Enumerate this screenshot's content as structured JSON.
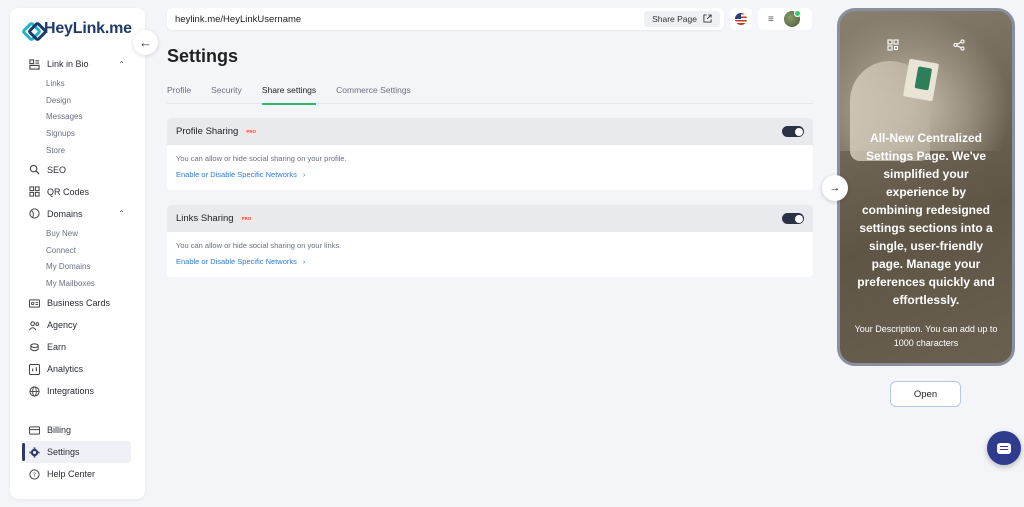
{
  "brand": {
    "name": "HeyLink.me",
    "color": "#1f3b6d",
    "accent": "#23b5c8"
  },
  "sidebar": {
    "items": [
      {
        "label": "Link in Bio",
        "icon": "layout-icon",
        "expanded": true,
        "children": [
          "Links",
          "Design",
          "Messages",
          "Signups",
          "Store"
        ]
      },
      {
        "label": "SEO",
        "icon": "search-icon"
      },
      {
        "label": "QR Codes",
        "icon": "grid-icon"
      },
      {
        "label": "Domains",
        "icon": "globe-icon",
        "expanded": true,
        "children": [
          "Buy New",
          "Connect",
          "My Domains",
          "My Mailboxes"
        ]
      },
      {
        "label": "Business Cards",
        "icon": "id-card-icon"
      },
      {
        "label": "Agency",
        "icon": "users-icon"
      },
      {
        "label": "Earn",
        "icon": "coins-icon"
      },
      {
        "label": "Analytics",
        "icon": "chart-icon"
      },
      {
        "label": "Integrations",
        "icon": "globe-icon"
      }
    ],
    "bottom": [
      {
        "label": "Billing",
        "icon": "credit-card-icon"
      },
      {
        "label": "Settings",
        "icon": "gear-icon",
        "active": true
      },
      {
        "label": "Help Center",
        "icon": "help-icon"
      }
    ]
  },
  "topbar": {
    "url": "heylink.me/HeyLinkUsername",
    "share_label": "Share Page"
  },
  "main": {
    "title": "Settings",
    "tabs": [
      {
        "label": "Profile"
      },
      {
        "label": "Security"
      },
      {
        "label": "Share settings",
        "active": true
      },
      {
        "label": "Commerce Settings"
      }
    ],
    "cards": [
      {
        "title": "Profile Sharing",
        "badge": "PRO",
        "toggle_on": true,
        "desc": "You can allow or hide social sharing on your profile.",
        "link": "Enable or Disable Specific Networks"
      },
      {
        "title": "Links Sharing",
        "badge": "PRO",
        "toggle_on": true,
        "desc": "You can allow or hide social sharing on your links.",
        "link": "Enable or Disable Specific Networks"
      }
    ]
  },
  "preview": {
    "headline": "All-New Centralized Settings Page. We've simplified your experience by combining redesigned settings sections into a single, user-friendly page. Manage your preferences quickly and effortlessly.",
    "description": "Your Description. You can add up to 1000 characters",
    "open_label": "Open"
  }
}
